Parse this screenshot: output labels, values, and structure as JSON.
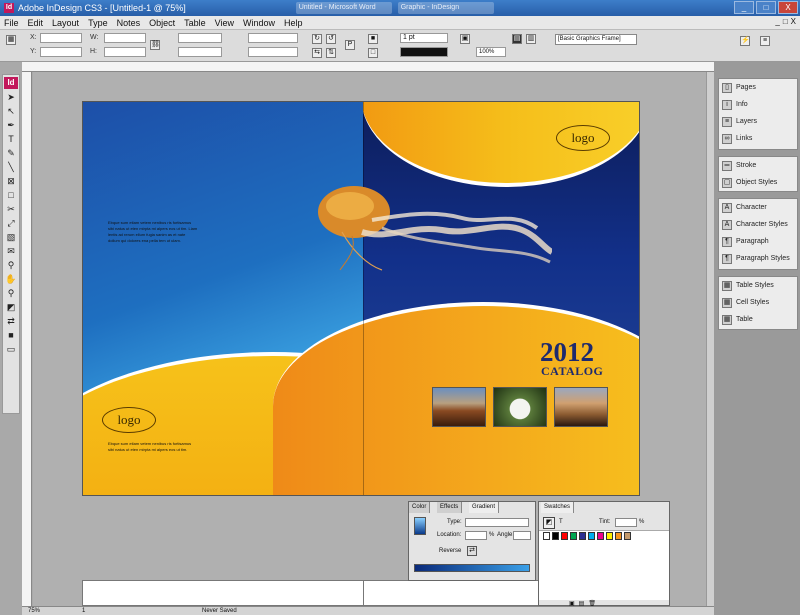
{
  "window": {
    "title": "Adobe InDesign CS3 - [Untitled-1 @ 75%]",
    "app_icon": "Id",
    "taskbar_tabs": [
      "Untitled - Microsoft Word",
      "Graphic - InDesign"
    ],
    "min_label": "_",
    "max_label": "□",
    "close_label": "X"
  },
  "menubar": {
    "items": [
      "File",
      "Edit",
      "Layout",
      "Type",
      "Notes",
      "Object",
      "Table",
      "View",
      "Window",
      "Help"
    ],
    "doc_controls": [
      "_",
      "□",
      "X"
    ]
  },
  "controlbar": {
    "x_label": "X:",
    "y_label": "Y:",
    "w_label": "W:",
    "h_label": "H:",
    "stroke_weight": "1 pt",
    "percent": "100%",
    "frame_style": "[Basic Graphics Frame]",
    "x_value": "",
    "y_value": ""
  },
  "document": {
    "left_logo": "logo",
    "right_logo": "logo",
    "left_text_top": "Ebque sum etiam vetem nenibus ris fortisamus sibi natus ut eten mirpta mi alpers eos ut tim. Liam lentis ad rerum ellum fugia sanim as et nate dollum qui dolores ena pella tem ut ulam.",
    "left_text_bottom": "Ebque sum etiam vetem nenibus ris fortisamus sibi natus ut eten mirpta mi alpers eos ut tim.",
    "catalog_year": "2012",
    "catalog_word": "CATALOG"
  },
  "right_panels": {
    "group1": [
      "Pages",
      "Info",
      "Layers",
      "Links"
    ],
    "group2": [
      "Stroke",
      "Object Styles"
    ],
    "group3": [
      "Character",
      "Character Styles",
      "Paragraph",
      "Paragraph Styles"
    ],
    "group4": [
      "Table Styles",
      "Cell Styles",
      "Table"
    ]
  },
  "gradient_panel": {
    "tabs": [
      "Color",
      "Effects",
      "Gradient"
    ],
    "type_label": "Type:",
    "location_label": "Location:",
    "angle_label": "Angle:",
    "reverse_label": "Reverse",
    "percent_sign": "%"
  },
  "swatches_panel": {
    "tab": "Swatches",
    "tint_label": "Tint:",
    "tint_value": "",
    "percent_sign": "%",
    "colors": [
      "#ffffff",
      "#000000",
      "#ff0000",
      "#00a651",
      "#2e3192",
      "#00aeef",
      "#ec008c",
      "#fff200",
      "#f7941d",
      "#c49a6c"
    ]
  },
  "statusbar": {
    "zoom": "75%",
    "page": "1",
    "master": "Never Saved"
  },
  "icons": {
    "selection": "selection-tool-icon",
    "direct": "direct-selection-tool-icon"
  }
}
